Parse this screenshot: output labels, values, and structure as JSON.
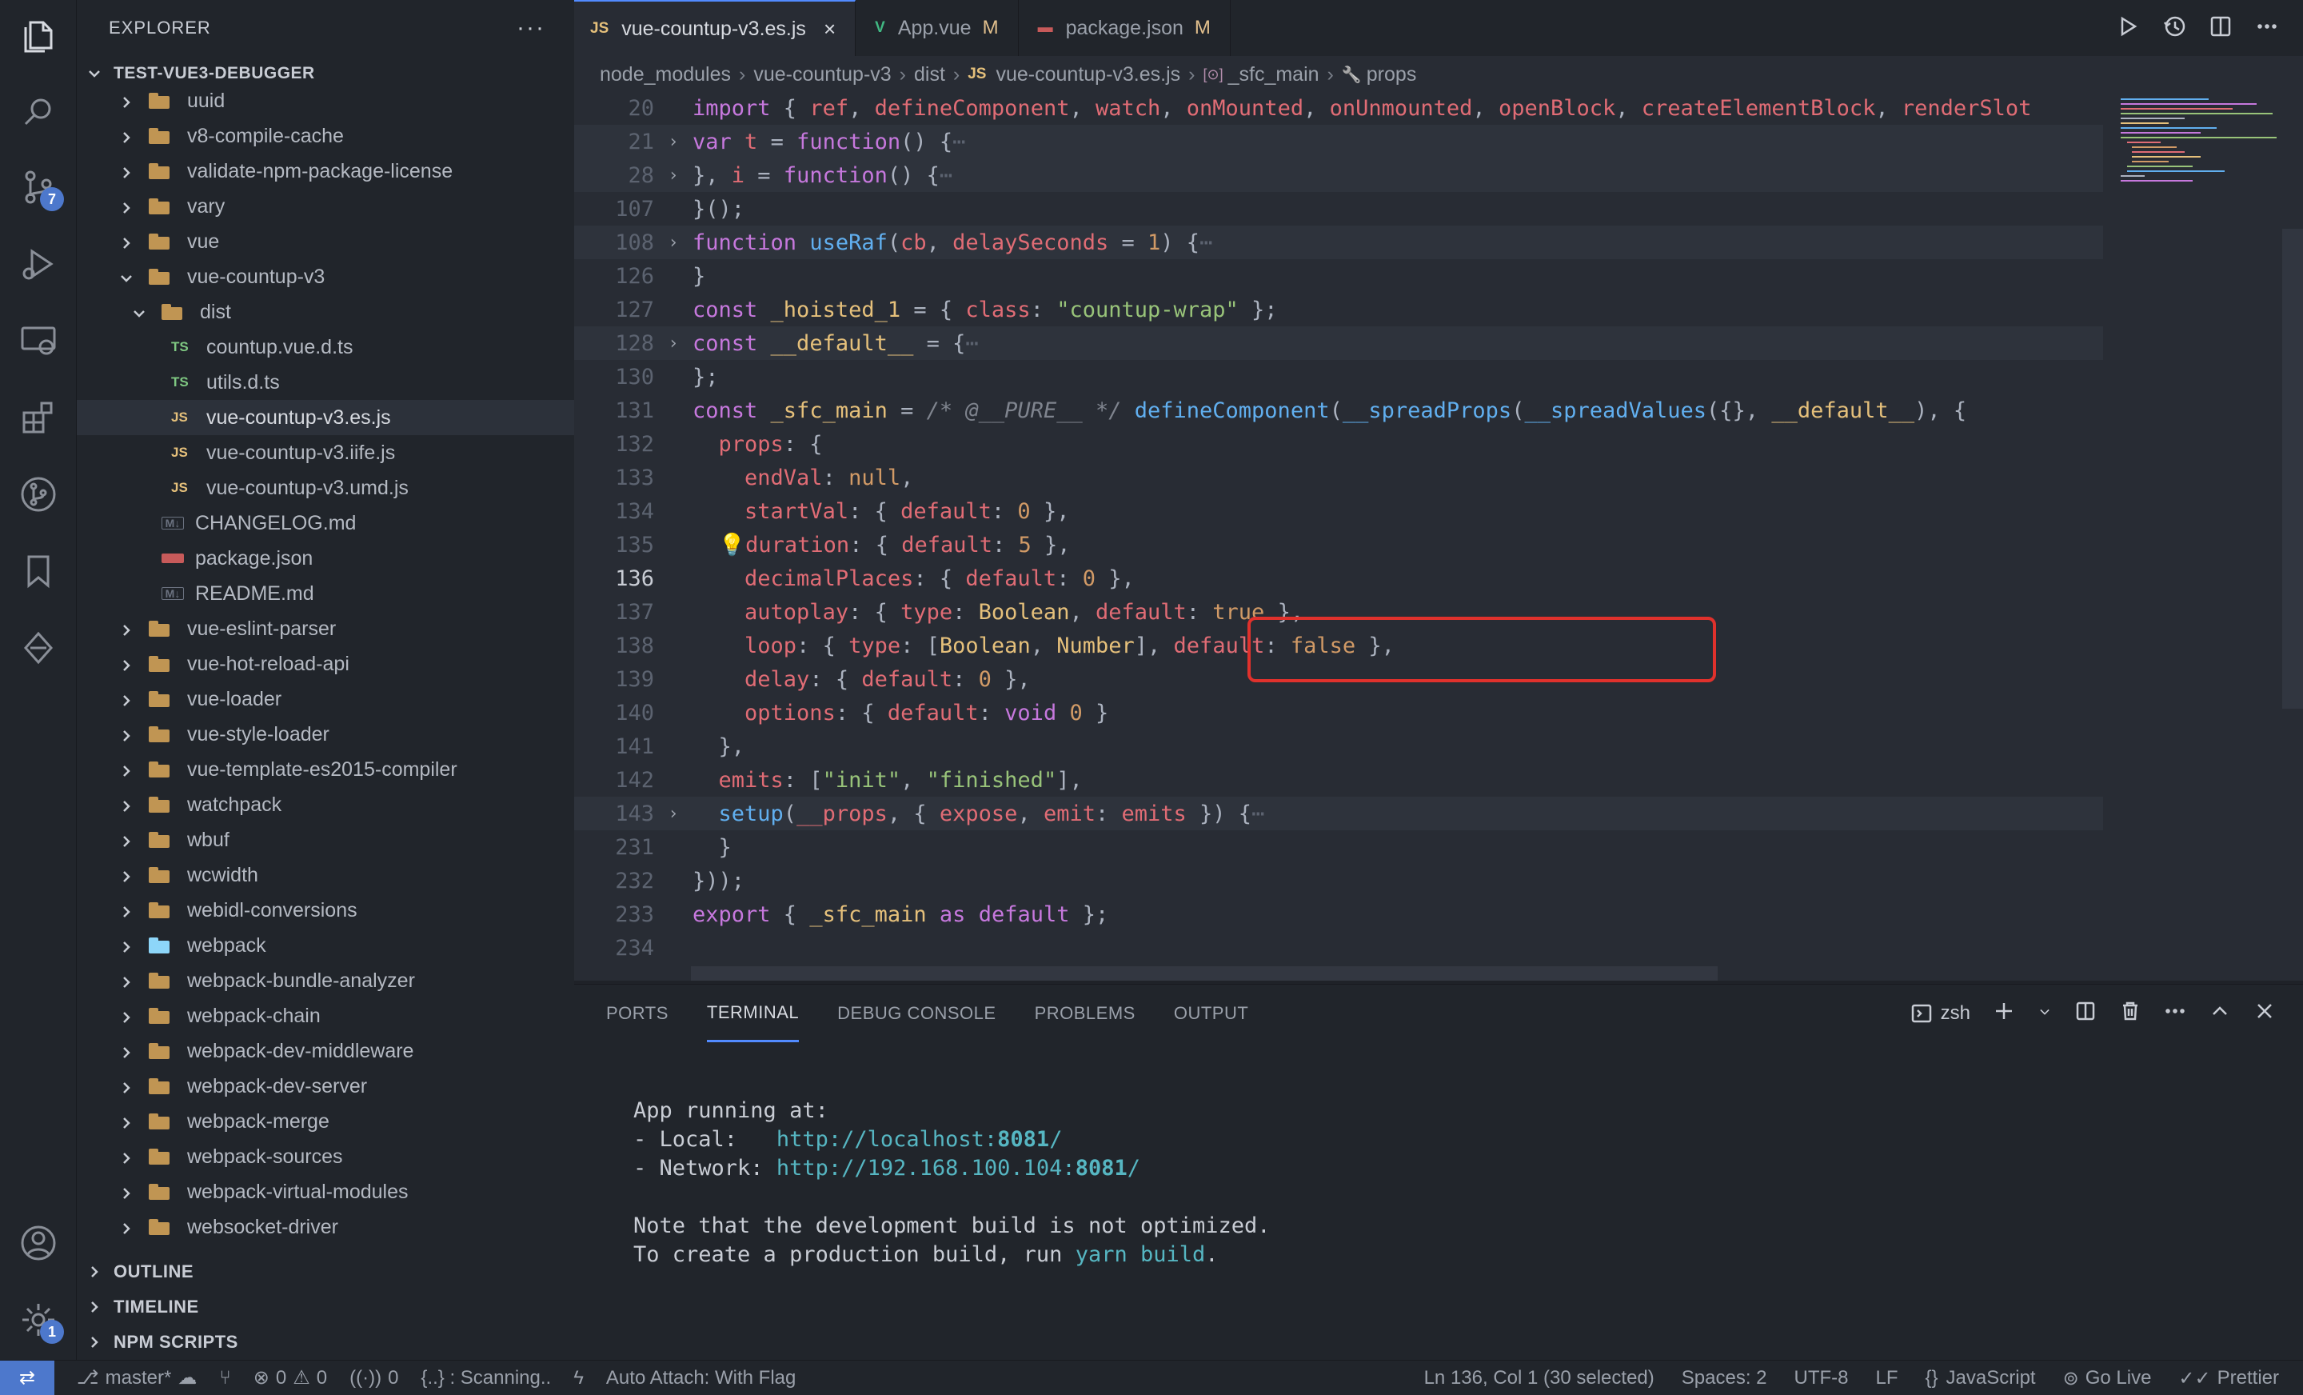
{
  "sidebar": {
    "title": "EXPLORER",
    "more": "···",
    "project": "TEST-VUE3-DEBUGGER",
    "tree": [
      {
        "label": "uuid",
        "type": "folder",
        "depth": 1
      },
      {
        "label": "v8-compile-cache",
        "type": "folder",
        "depth": 1
      },
      {
        "label": "validate-npm-package-license",
        "type": "folder",
        "depth": 1
      },
      {
        "label": "vary",
        "type": "folder",
        "depth": 1
      },
      {
        "label": "vue",
        "type": "folder",
        "depth": 1
      },
      {
        "label": "vue-countup-v3",
        "type": "folder",
        "depth": 1,
        "open": true
      },
      {
        "label": "dist",
        "type": "folder",
        "depth": 2,
        "open": true
      },
      {
        "label": "countup.vue.d.ts",
        "type": "ts",
        "icon": "TS",
        "depth": 3
      },
      {
        "label": "utils.d.ts",
        "type": "ts",
        "icon": "TS",
        "depth": 3
      },
      {
        "label": "vue-countup-v3.es.js",
        "type": "js",
        "icon": "JS",
        "depth": 3,
        "selected": true
      },
      {
        "label": "vue-countup-v3.iife.js",
        "type": "js",
        "icon": "JS",
        "depth": 3
      },
      {
        "label": "vue-countup-v3.umd.js",
        "type": "js",
        "icon": "JS",
        "depth": 3
      },
      {
        "label": "CHANGELOG.md",
        "type": "md",
        "icon": "M↓",
        "depth": 2
      },
      {
        "label": "package.json",
        "type": "json",
        "icon": "",
        "depth": 2
      },
      {
        "label": "README.md",
        "type": "md",
        "icon": "M↓",
        "depth": 2
      },
      {
        "label": "vue-eslint-parser",
        "type": "folder",
        "depth": 1
      },
      {
        "label": "vue-hot-reload-api",
        "type": "folder",
        "depth": 1
      },
      {
        "label": "vue-loader",
        "type": "folder",
        "depth": 1
      },
      {
        "label": "vue-style-loader",
        "type": "folder",
        "depth": 1
      },
      {
        "label": "vue-template-es2015-compiler",
        "type": "folder",
        "depth": 1
      },
      {
        "label": "watchpack",
        "type": "folder",
        "depth": 1
      },
      {
        "label": "wbuf",
        "type": "folder",
        "depth": 1
      },
      {
        "label": "wcwidth",
        "type": "folder",
        "depth": 1
      },
      {
        "label": "webidl-conversions",
        "type": "folder",
        "depth": 1
      },
      {
        "label": "webpack",
        "type": "folder",
        "depth": 1,
        "special": "webpack"
      },
      {
        "label": "webpack-bundle-analyzer",
        "type": "folder",
        "depth": 1
      },
      {
        "label": "webpack-chain",
        "type": "folder",
        "depth": 1
      },
      {
        "label": "webpack-dev-middleware",
        "type": "folder",
        "depth": 1
      },
      {
        "label": "webpack-dev-server",
        "type": "folder",
        "depth": 1
      },
      {
        "label": "webpack-merge",
        "type": "folder",
        "depth": 1
      },
      {
        "label": "webpack-sources",
        "type": "folder",
        "depth": 1
      },
      {
        "label": "webpack-virtual-modules",
        "type": "folder",
        "depth": 1
      },
      {
        "label": "websocket-driver",
        "type": "folder",
        "depth": 1
      }
    ],
    "sections": [
      "OUTLINE",
      "TIMELINE",
      "NPM SCRIPTS"
    ]
  },
  "activity": {
    "scm_badge": "7",
    "settings_badge": "1"
  },
  "tabs": [
    {
      "icon": "JS",
      "icon_color": "#e5c07b",
      "label": "vue-countup-v3.es.js",
      "active": true,
      "close": "×",
      "modified": ""
    },
    {
      "icon": "V",
      "icon_color": "#41b883",
      "label": "App.vue",
      "active": false,
      "close": "",
      "modified": "M"
    },
    {
      "icon": "▬",
      "icon_color": "#c75a5a",
      "label": "package.json",
      "active": false,
      "close": "",
      "modified": "M"
    }
  ],
  "breadcrumb": {
    "parts": [
      "node_modules",
      "vue-countup-v3",
      "dist"
    ],
    "file_icon": "JS",
    "file": "vue-countup-v3.es.js",
    "symbol_icon": "[⊙]",
    "symbol": "_sfc_main",
    "prop_icon": "🔧",
    "prop": "props"
  },
  "editor": {
    "current_line": "136",
    "lines": [
      {
        "n": "20",
        "html": "<span class=\"kw\">import</span> { <span class=\"prop\">ref</span>, <span class=\"prop\">defineComponent</span>, <span class=\"prop\">watch</span>, <span class=\"prop\">onMounted</span>, <span class=\"prop\">onUnmounted</span>, <span class=\"prop\">openBlock</span>, <span class=\"prop\">createElementBlock</span>, <span class=\"prop\">renderSlot</span>"
      },
      {
        "n": "21",
        "fold": "›",
        "folded": true,
        "html": "<span class=\"kw\">var</span> <span class=\"prop\">t</span> = <span class=\"kw\">function</span>() {<span class=\"dim\">⋯</span>"
      },
      {
        "n": "28",
        "fold": "›",
        "folded": true,
        "html": "}, <span class=\"prop\">i</span> = <span class=\"kw\">function</span>() {<span class=\"dim\">⋯</span>"
      },
      {
        "n": "107",
        "html": "}();"
      },
      {
        "n": "108",
        "fold": "›",
        "folded": true,
        "html": "<span class=\"kw\">function</span> <span class=\"fn\">useRaf</span>(<span class=\"prop\">cb</span>, <span class=\"prop\">delaySeconds</span> = <span class=\"num\">1</span>) {<span class=\"dim\">⋯</span>"
      },
      {
        "n": "126",
        "html": "}"
      },
      {
        "n": "127",
        "html": "<span class=\"kw\">const</span> <span class=\"cls\">_hoisted_1</span> = { <span class=\"prop\">class</span>: <span class=\"str\">\"countup-wrap\"</span> };"
      },
      {
        "n": "128",
        "fold": "›",
        "folded": true,
        "html": "<span class=\"kw\">const</span> <span class=\"cls\">__default__</span> = {<span class=\"dim\">⋯</span>"
      },
      {
        "n": "130",
        "html": "};"
      },
      {
        "n": "131",
        "html": "<span class=\"kw\">const</span> <span class=\"cls\">_sfc_main</span> = <span class=\"cmt\">/* @__PURE__ */</span> <span class=\"fn\">defineComponent</span>(<span class=\"fn\">__spreadProps</span>(<span class=\"fn\">__spreadValues</span>({}, <span class=\"cls\">__default__</span>), {"
      },
      {
        "n": "132",
        "html": "  <span class=\"prop\">props</span>: {"
      },
      {
        "n": "133",
        "html": "    <span class=\"prop\">endVal</span>: <span class=\"num\">null</span>,"
      },
      {
        "n": "134",
        "html": "    <span class=\"prop\">startVal</span>: { <span class=\"prop\">default</span>: <span class=\"num\">0</span> },"
      },
      {
        "n": "135",
        "html": "  <span class=\"bulb\">💡</span><span class=\"prop\">duration</span>: { <span class=\"prop\">default</span>: <span class=\"num\">5</span> },"
      },
      {
        "n": "136",
        "html": "    <span class=\"prop\">decimalPlaces</span>: { <span class=\"prop\">default</span>: <span class=\"num\">0</span> },"
      },
      {
        "n": "137",
        "html": "    <span class=\"prop\">autoplay</span>: { <span class=\"prop\">type</span>: <span class=\"cls\">Boolean</span>, <span class=\"prop\">default</span>: <span class=\"num\">true</span> },"
      },
      {
        "n": "138",
        "html": "    <span class=\"prop\">loop</span>: { <span class=\"prop\">type</span>: [<span class=\"cls\">Boolean</span>, <span class=\"cls\">Number</span>], <span class=\"prop\">default</span>: <span class=\"num\">false</span> },"
      },
      {
        "n": "139",
        "html": "    <span class=\"prop\">delay</span>: { <span class=\"prop\">default</span>: <span class=\"num\">0</span> },"
      },
      {
        "n": "140",
        "html": "    <span class=\"prop\">options</span>: { <span class=\"prop\">default</span>: <span class=\"kw\">void</span> <span class=\"num\">0</span> }"
      },
      {
        "n": "141",
        "html": "  },"
      },
      {
        "n": "142",
        "html": "  <span class=\"prop\">emits</span>: [<span class=\"str\">\"init\"</span>, <span class=\"str\">\"finished\"</span>],"
      },
      {
        "n": "143",
        "fold": "›",
        "folded": true,
        "html": "  <span class=\"fn\">setup</span>(<span class=\"prop\">__props</span>, { <span class=\"prop\">expose</span>, <span class=\"prop\">emit</span>: <span class=\"prop\">emits</span> }) {<span class=\"dim\">⋯</span>"
      },
      {
        "n": "231",
        "html": "  }"
      },
      {
        "n": "232",
        "html": "}));"
      },
      {
        "n": "233",
        "html": "<span class=\"kw\">export</span> { <span class=\"cls\">_sfc_main</span> <span class=\"kw\">as</span> <span class=\"kw\">default</span> };"
      },
      {
        "n": "234",
        "html": ""
      }
    ]
  },
  "panel": {
    "tabs": [
      "PORTS",
      "TERMINAL",
      "DEBUG CONSOLE",
      "PROBLEMS",
      "OUTPUT"
    ],
    "active_tab": "TERMINAL",
    "shell": "zsh",
    "terminal": {
      "line1": "App running at:",
      "local_label": "- Local:   ",
      "local_url": "http://localhost:",
      "local_port": "8081",
      "local_tail": "/",
      "network_label": "- Network: ",
      "network_url": "http://192.168.100.104:",
      "network_port": "8081",
      "network_tail": "/",
      "note1": "Note that the development build is not optimized.",
      "note2_pre": "To create a production build, run ",
      "note2_cmd": "yarn build",
      "note2_post": "."
    }
  },
  "status": {
    "branch": "master*",
    "errors": "0",
    "warnings": "0",
    "ports": "0",
    "scanning": "{..} : Scanning..",
    "auto_attach": "Auto Attach: With Flag",
    "position": "Ln 136, Col 1 (30 selected)",
    "spaces": "Spaces: 2",
    "encoding": "UTF-8",
    "eol": "LF",
    "language": "JavaScript",
    "golive": "Go Live",
    "prettier": "Prettier"
  }
}
